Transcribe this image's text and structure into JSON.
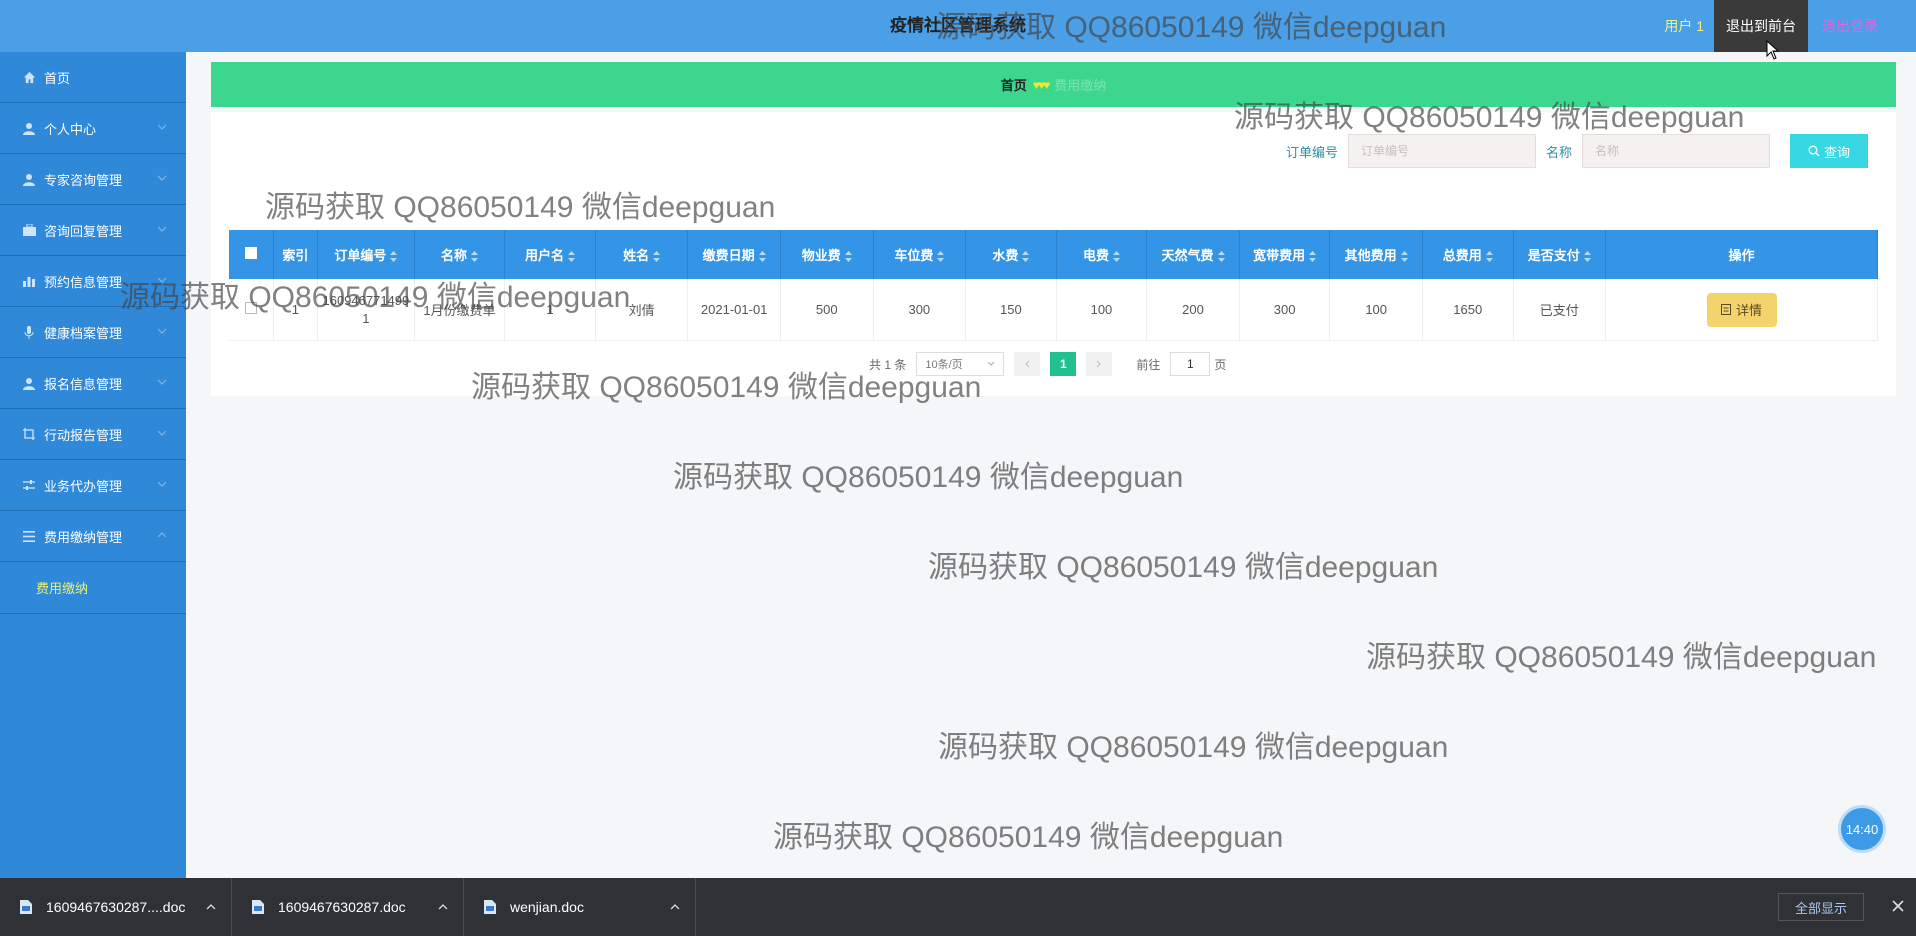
{
  "header": {
    "title": "疫情社区管理系统",
    "user": "用户 1",
    "front_button": "退出到前台",
    "logout": "退出登录"
  },
  "sidebar": {
    "items": [
      {
        "label": "首页",
        "icon": "home-icon"
      },
      {
        "label": "个人中心",
        "icon": "user-icon"
      },
      {
        "label": "专家咨询管理",
        "icon": "user-icon"
      },
      {
        "label": "咨询回复管理",
        "icon": "briefcase-icon"
      },
      {
        "label": "预约信息管理",
        "icon": "bar-chart-icon"
      },
      {
        "label": "健康档案管理",
        "icon": "mic-icon"
      },
      {
        "label": "报名信息管理",
        "icon": "user-icon"
      },
      {
        "label": "行动报告管理",
        "icon": "crop-icon"
      },
      {
        "label": "业务代办管理",
        "icon": "sliders-icon"
      },
      {
        "label": "费用缴纳管理",
        "icon": "menu-icon"
      }
    ],
    "sub_item": "费用缴纳"
  },
  "breadcrumb": {
    "home": "首页",
    "separator": "♥♥♥",
    "current": "费用缴纳"
  },
  "search": {
    "order_label": "订单编号",
    "order_placeholder": "订单编号",
    "name_label": "名称",
    "name_placeholder": "名称",
    "button": "查询"
  },
  "table": {
    "columns": [
      "索引",
      "订单编号",
      "名称",
      "用户名",
      "姓名",
      "缴费日期",
      "物业费",
      "车位费",
      "水费",
      "电费",
      "天然气费",
      "宽带费用",
      "其他费用",
      "总费用",
      "是否支付",
      "操作"
    ],
    "rows": [
      {
        "index": "1",
        "order_no": "1609467714991",
        "name": "1月份缴费单",
        "username": "1",
        "realname": "刘倩",
        "date": "2021-01-01",
        "property_fee": "500",
        "parking_fee": "300",
        "water_fee": "150",
        "electric_fee": "100",
        "gas_fee": "200",
        "broadband_fee": "300",
        "other_fee": "100",
        "total": "1650",
        "paid": "已支付",
        "action": "详情"
      }
    ]
  },
  "pagination": {
    "total": "共 1 条",
    "page_size": "10条/页",
    "current_page": "1",
    "goto_label": "前往",
    "goto_value": "1",
    "page_suffix": "页"
  },
  "watermark": "源码获取 QQ86050149 微信deepguan",
  "clock": "14:40",
  "taskbar": {
    "downloads": [
      "1609467630287....doc",
      "1609467630287.doc",
      "wenjian.doc"
    ],
    "show_all": "全部显示"
  },
  "colors": {
    "header": "#4a9fe6",
    "sidebar": "#2f88d8",
    "breadcrumb": "#3cd68f",
    "table_header": "#3495e6",
    "search_button": "#37d7e4",
    "detail_button": "#f3d36b",
    "pager_active": "#21c08f"
  }
}
